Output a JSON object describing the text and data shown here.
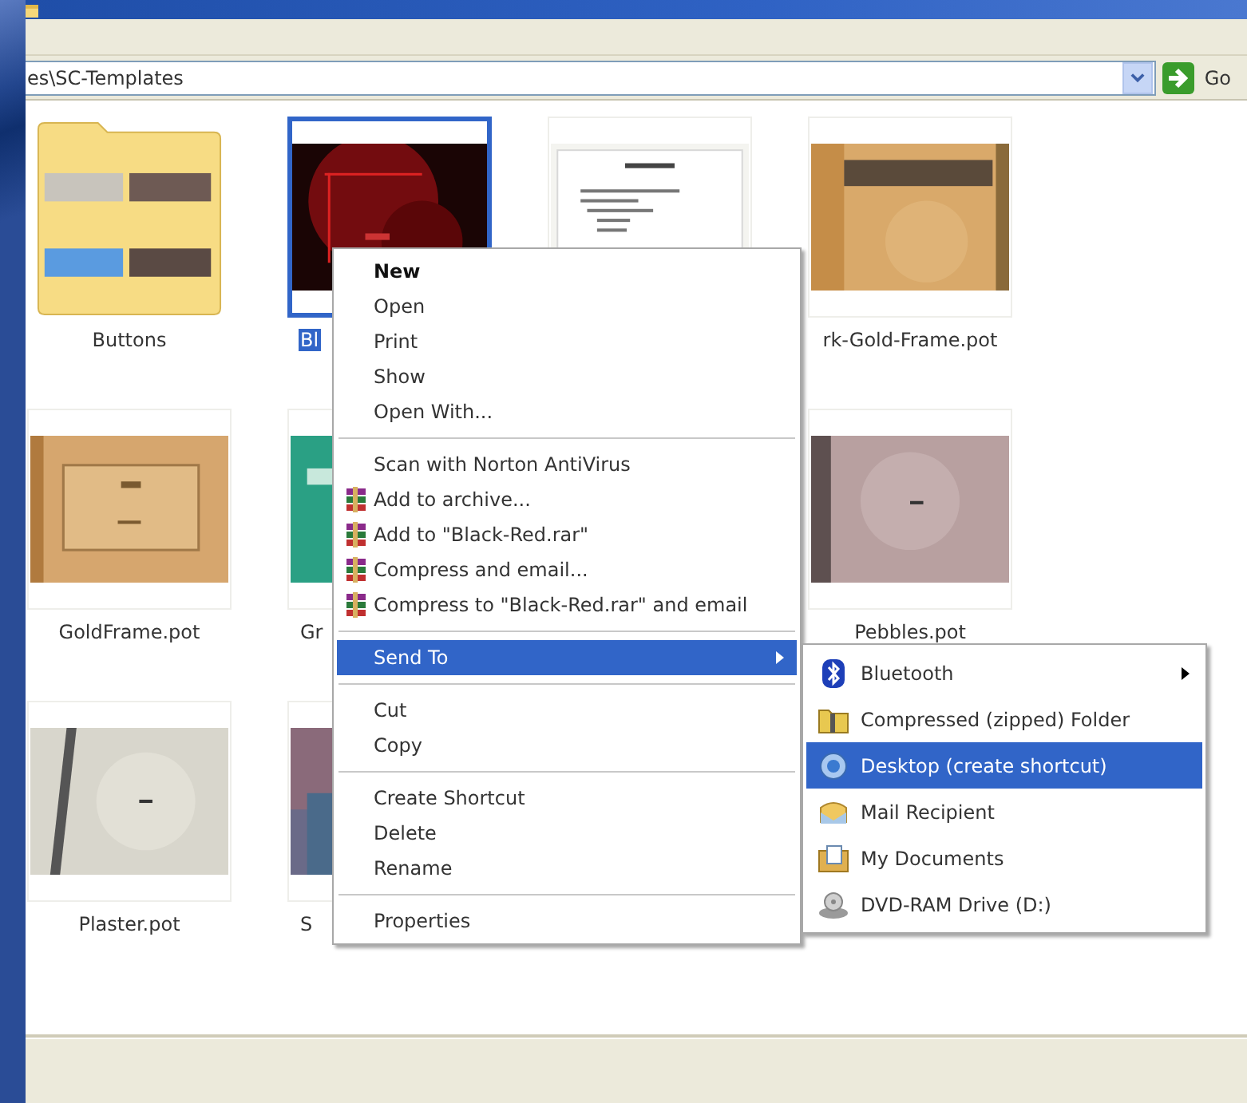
{
  "address_bar": {
    "path": "es\\SC-Templates",
    "go_label": "Go"
  },
  "tiles": [
    {
      "kind": "folder",
      "label": "Buttons",
      "selected": false
    },
    {
      "kind": "slide",
      "label": "Bl",
      "selected": true
    },
    {
      "kind": "slide",
      "selected": false
    },
    {
      "kind": "slide",
      "label": "rk-Gold-Frame.pot",
      "selected": false
    },
    {
      "kind": "slide",
      "label": "GoldFrame.pot",
      "selected": false
    },
    {
      "kind": "slide",
      "label": "Gr",
      "selected": false
    },
    {
      "kind": "hidden"
    },
    {
      "kind": "slide",
      "label": "Pebbles.pot",
      "selected": false
    },
    {
      "kind": "slide",
      "label": "Plaster.pot",
      "selected": false
    },
    {
      "kind": "slide",
      "label": "S",
      "selected": false
    },
    {
      "kind": "hidden"
    },
    {
      "kind": "hidden"
    }
  ],
  "context_menu": {
    "items": [
      {
        "kind": "command",
        "label": "New",
        "default": true,
        "selected": false
      },
      {
        "kind": "command",
        "label": "Open",
        "default": false,
        "selected": false
      },
      {
        "kind": "command",
        "label": "Print",
        "default": false,
        "selected": false
      },
      {
        "kind": "command",
        "label": "Show",
        "default": false,
        "selected": false
      },
      {
        "kind": "command",
        "label": "Open With...",
        "default": false,
        "selected": false
      },
      {
        "kind": "separator"
      },
      {
        "kind": "command",
        "label": "Scan with Norton AntiVirus",
        "default": false,
        "selected": false
      },
      {
        "kind": "archive",
        "label": "Add to archive...",
        "default": false,
        "selected": false
      },
      {
        "kind": "archive",
        "label": "Add to \"Black-Red.rar\"",
        "default": false,
        "selected": false
      },
      {
        "kind": "archive",
        "label": "Compress and email...",
        "default": false,
        "selected": false
      },
      {
        "kind": "archive",
        "label": "Compress to \"Black-Red.rar\" and email",
        "default": false,
        "selected": false
      },
      {
        "kind": "separator"
      },
      {
        "kind": "submenu",
        "label": "Send To",
        "default": false,
        "selected": true
      },
      {
        "kind": "separator"
      },
      {
        "kind": "command",
        "label": "Cut",
        "default": false,
        "selected": false
      },
      {
        "kind": "command",
        "label": "Copy",
        "default": false,
        "selected": false
      },
      {
        "kind": "separator"
      },
      {
        "kind": "command",
        "label": "Create Shortcut",
        "default": false,
        "selected": false
      },
      {
        "kind": "command",
        "label": "Delete",
        "default": false,
        "selected": false
      },
      {
        "kind": "command",
        "label": "Rename",
        "default": false,
        "selected": false
      },
      {
        "kind": "separator"
      },
      {
        "kind": "command",
        "label": "Properties",
        "default": false,
        "selected": false
      }
    ]
  },
  "send_to_menu": {
    "items": [
      {
        "kind": "bluetooth",
        "label": "Bluetooth",
        "submenu": true,
        "selected": false
      },
      {
        "kind": "zip-folder",
        "label": "Compressed (zipped) Folder",
        "submenu": false,
        "selected": false
      },
      {
        "kind": "desktop",
        "label": "Desktop (create shortcut)",
        "submenu": false,
        "selected": true
      },
      {
        "kind": "mail",
        "label": "Mail Recipient",
        "submenu": false,
        "selected": false
      },
      {
        "kind": "documents",
        "label": "My Documents",
        "submenu": false,
        "selected": false
      },
      {
        "kind": "drive",
        "label": "DVD-RAM Drive (D:)",
        "submenu": false,
        "selected": false
      }
    ]
  }
}
